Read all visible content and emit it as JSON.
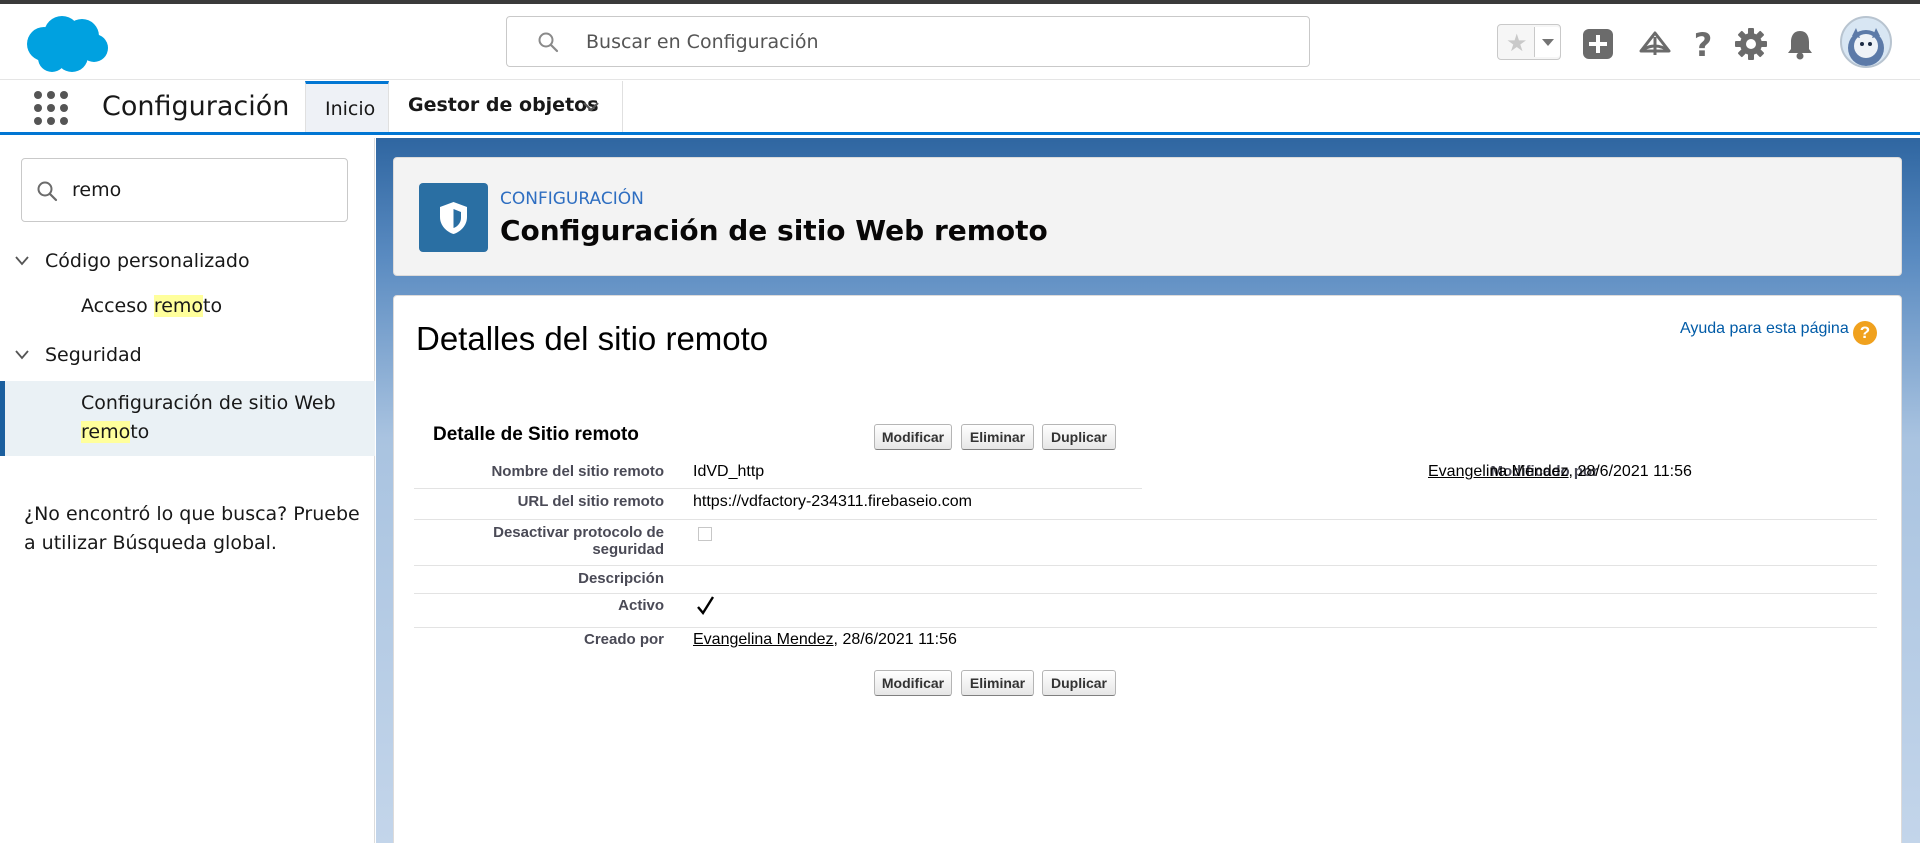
{
  "header": {
    "search_placeholder": "Buscar en Configuración"
  },
  "nav": {
    "app_name": "Configuración",
    "tabs": [
      {
        "label": "Inicio"
      },
      {
        "label": "Gestor de objetos"
      }
    ]
  },
  "sidebar": {
    "quickfind_value": "remo",
    "groups": [
      {
        "label": "Código personalizado",
        "items": [
          {
            "label_pre": "Acceso ",
            "label_hl": "remo",
            "label_post": "to"
          }
        ]
      },
      {
        "label": "Seguridad",
        "items": [
          {
            "label_pre": "Configuración de sitio Web ",
            "label_hl": "remo",
            "label_post": "to"
          }
        ]
      }
    ],
    "not_found": "¿No encontró lo que busca? Pruebe a utilizar Búsqueda global."
  },
  "page_header": {
    "eyebrow": "CONFIGURACIÓN",
    "title": "Configuración de sitio Web remoto"
  },
  "panel": {
    "title": "Detalles del sitio remoto",
    "help_link": "Ayuda para esta página",
    "help_icon_text": "?",
    "detail_title": "Detalle de Sitio remoto",
    "buttons": {
      "edit": "Modificar",
      "delete": "Eliminar",
      "clone": "Duplicar"
    },
    "fields": {
      "name_label": "Nombre del sitio remoto",
      "name_value": "IdVD_http",
      "url_label": "URL del sitio remoto",
      "url_value": "https://vdfactory-234311.firebaseio.com",
      "disable_label_1": "Desactivar protocolo de",
      "disable_label_2": "seguridad",
      "disable_value": false,
      "description_label": "Descripción",
      "description_value": "",
      "active_label": "Activo",
      "active_value": true,
      "created_label": "Creado por",
      "created_user": "Evangelina Mendez",
      "created_date": ", 28/6/2021 11:56",
      "modified_label": "Modificado por",
      "modified_user": "Evangelina Mendez",
      "modified_date": ", 28/6/2021 11:56"
    }
  },
  "colors": {
    "brand_blue": "#0176d3",
    "salesforce_cloud": "#00a1e0",
    "highlight": "#ffff9c",
    "help_orange": "#f0a11e"
  }
}
